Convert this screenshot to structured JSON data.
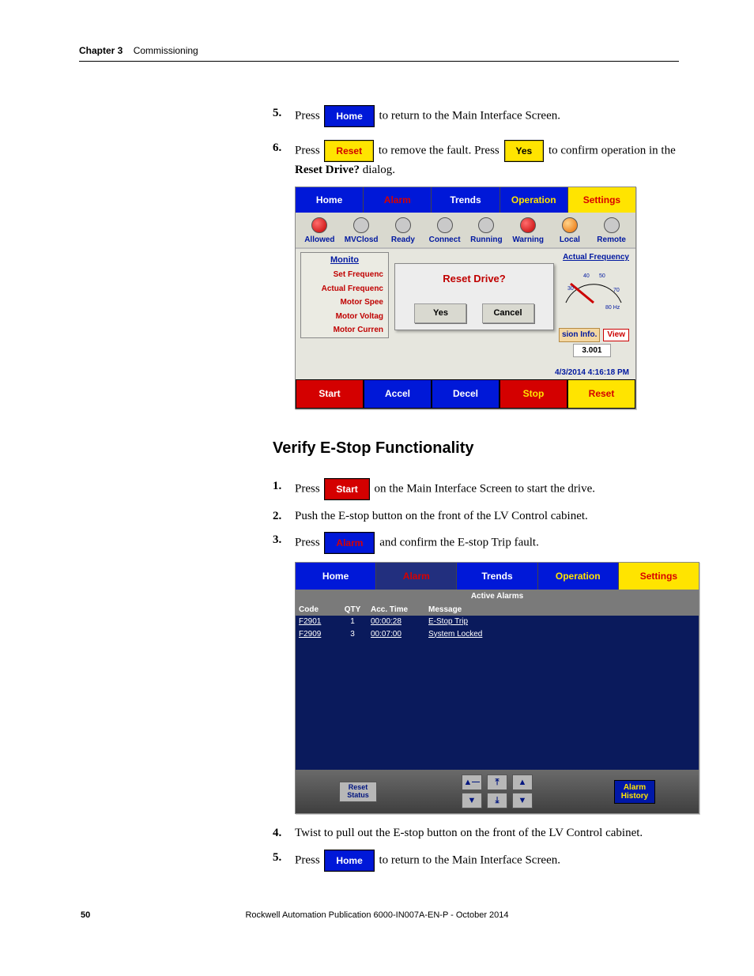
{
  "header": {
    "chapter": "Chapter 3",
    "title": "Commissioning"
  },
  "steps_a": {
    "s5_pre": "Press",
    "s5_btn": "Home",
    "s5_post": "to return to the Main Interface Screen.",
    "s6_pre": "Press",
    "s6_btn1": "Reset",
    "s6_mid": "to remove the fault. Press",
    "s6_btn2": "Yes",
    "s6_post": "to confirm operation in the ",
    "s6_bold": "Reset Drive?",
    "s6_tail": " dialog."
  },
  "shot1": {
    "tabs": {
      "home": "Home",
      "alarm": "Alarm",
      "trends": "Trends",
      "operation": "Operation",
      "settings": "Settings"
    },
    "lamps": {
      "allowed": "Allowed",
      "mvclosd": "MVClosd",
      "ready": "Ready",
      "connect": "Connect",
      "running": "Running",
      "warning": "Warning",
      "local": "Local",
      "remote": "Remote"
    },
    "sidelist": {
      "hdr": "Monito",
      "r1": "Set Frequenc",
      "r2": "Actual Frequenc",
      "r3": "Motor Spee",
      "r4": "Motor Voltag",
      "r5": "Motor Curren"
    },
    "dialog": {
      "title": "Reset Drive?",
      "yes": "Yes",
      "cancel": "Cancel"
    },
    "gauge": {
      "label": "Actual Frequency",
      "tick30": "30",
      "tick40": "40",
      "tick50": "50",
      "tick70": "70",
      "unit": "80 Hz"
    },
    "info": {
      "label": "sion Info.",
      "view": "View",
      "val": "3.001",
      "ts": "4/3/2014 4:16:18 PM"
    },
    "bottom": {
      "start": "Start",
      "accel": "Accel",
      "decel": "Decel",
      "stop": "Stop",
      "reset": "Reset"
    }
  },
  "section_h": "Verify E-Stop Functionality",
  "steps_b": {
    "s1_pre": "Press",
    "s1_btn": "Start",
    "s1_post": "on the Main Interface Screen to start the drive.",
    "s2": "Push the E-stop button on the front of the LV Control cabinet.",
    "s3_pre": "Press",
    "s3_btn": "Alarm",
    "s3_post": "and confirm the E-stop Trip fault."
  },
  "shot2": {
    "tabs": {
      "home": "Home",
      "alarm": "Alarm",
      "trends": "Trends",
      "operation": "Operation",
      "settings": "Settings"
    },
    "active": "Active Alarms",
    "cols": {
      "code": "Code",
      "qty": "QTY",
      "time": "Acc. Time",
      "msg": "Message"
    },
    "rows": [
      {
        "code": "F2901",
        "qty": "1",
        "time": "00:00:28",
        "msg": "E-Stop Trip"
      },
      {
        "code": "F2909",
        "qty": "3",
        "time": "00:07:00",
        "msg": "System Locked"
      }
    ],
    "footer": {
      "reset_status": "Reset\nStatus",
      "alarm_history": "Alarm\nHistory"
    }
  },
  "steps_c": {
    "s4": "Twist to pull out the E-stop button on the front of the LV Control cabinet.",
    "s5_pre": "Press",
    "s5_btn": "Home",
    "s5_post": "to return to the Main Interface Screen."
  },
  "footer": {
    "pagenum": "50",
    "pub": "Rockwell Automation Publication 6000-IN007A-EN-P - October 2014"
  }
}
